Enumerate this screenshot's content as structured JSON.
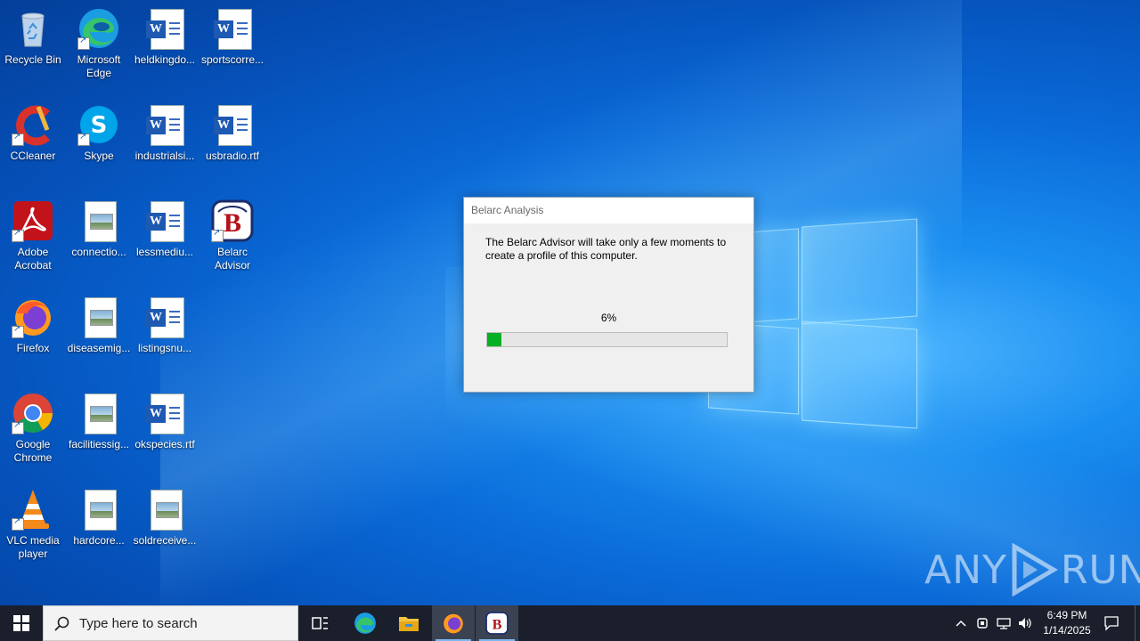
{
  "desktop": {
    "icons": [
      {
        "label": "Recycle Bin"
      },
      {
        "label": "Microsoft Edge"
      },
      {
        "label": "heldkingdo..."
      },
      {
        "label": "sportscorre..."
      },
      {
        "label": "CCleaner"
      },
      {
        "label": "Skype"
      },
      {
        "label": "industrialsi..."
      },
      {
        "label": "usbradio.rtf"
      },
      {
        "label": "Adobe Acrobat"
      },
      {
        "label": "connectio..."
      },
      {
        "label": "lessmediu..."
      },
      {
        "label": "Belarc Advisor"
      },
      {
        "label": "Firefox"
      },
      {
        "label": "diseasemig..."
      },
      {
        "label": "listingsnu..."
      },
      {
        "label": "Google Chrome"
      },
      {
        "label": "facilitiessig..."
      },
      {
        "label": "okspecies.rtf"
      },
      {
        "label": "VLC media player"
      },
      {
        "label": "hardcore..."
      },
      {
        "label": "soldreceive..."
      }
    ]
  },
  "dialog": {
    "title": "Belarc Analysis",
    "message": "The Belarc Advisor will take only a few moments to create a profile of this computer.",
    "percent_label": "6%",
    "progress": 0.06,
    "progress_color": "#06b025"
  },
  "watermark": {
    "left": "ANY",
    "right": "RUN"
  },
  "taskbar": {
    "search_placeholder": "Type here to search",
    "clock_time": "6:49 PM",
    "clock_date": "1/14/2025",
    "pinned": [
      "task-view-icon",
      "edge-icon",
      "file-explorer-icon",
      "firefox-icon",
      "belarc-icon"
    ]
  }
}
